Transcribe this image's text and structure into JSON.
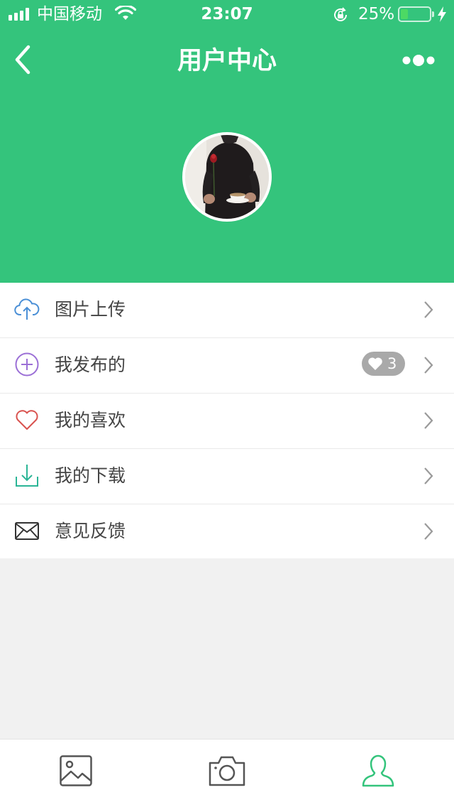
{
  "status_bar": {
    "carrier": "中国移动",
    "time": "23:07",
    "battery_percent": "25%",
    "battery_level": 0.25,
    "icons": [
      "signal-icon",
      "wifi-icon",
      "orientation-lock-icon",
      "battery-icon",
      "charging-bolt-icon"
    ]
  },
  "nav": {
    "title": "用户中心",
    "back_icon": "chevron-left-icon",
    "more_icon": "more-dots-icon"
  },
  "profile": {
    "avatar": "user-avatar-photo"
  },
  "menu": {
    "items": [
      {
        "label": "图片上传",
        "icon": "cloud-upload-icon",
        "icon_color": "#4a8fd6"
      },
      {
        "label": "我发布的",
        "icon": "plus-circle-icon",
        "icon_color": "#9b6fd6",
        "badge": {
          "icon": "heart-icon",
          "count": "3"
        }
      },
      {
        "label": "我的喜欢",
        "icon": "heart-outline-icon",
        "icon_color": "#d9534f"
      },
      {
        "label": "我的下载",
        "icon": "download-icon",
        "icon_color": "#2bb596"
      },
      {
        "label": "意见反馈",
        "icon": "mail-icon",
        "icon_color": "#333333"
      }
    ]
  },
  "tab_bar": {
    "tabs": [
      {
        "icon": "image-icon",
        "active": false
      },
      {
        "icon": "camera-icon",
        "active": false
      },
      {
        "icon": "user-icon",
        "active": true
      }
    ]
  },
  "colors": {
    "brand_green": "#34c47c",
    "background": "#f1f1f1",
    "badge_gray": "#a9a9a9",
    "chevron_gray": "#9a9a9a"
  }
}
